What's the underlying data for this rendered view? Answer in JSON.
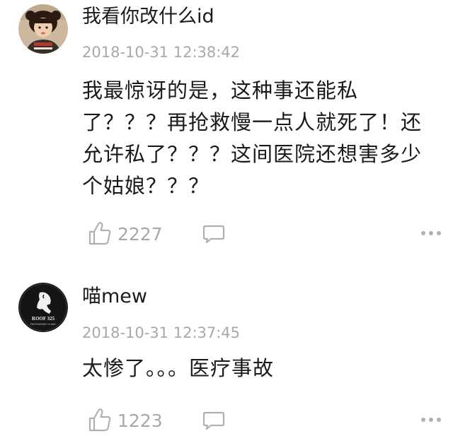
{
  "comments": [
    {
      "username": "我看你改什么id",
      "timestamp": "2018-10-31 12:38:42",
      "content": "我最惊讶的是，这种事还能私了？？？再抢救慢一点人就死了！还允许私了？？？这间医院还想害多少个姑娘？？？",
      "like_count": "2227",
      "avatar_icon": "child-photo-avatar"
    },
    {
      "username": "喵mew",
      "timestamp": "2018-10-31 12:37:45",
      "content": "太惨了。。。医疗事故",
      "like_count": "1223",
      "avatar_icon": "restaurant-logo-avatar",
      "avatar_text": "ROOF 325",
      "avatar_subtext": "RESTAURANT & BAR"
    }
  ],
  "colors": {
    "meta_gray": "#a8a8a8",
    "text": "#1a1a1a",
    "icon_gray": "#b0b0b0"
  }
}
